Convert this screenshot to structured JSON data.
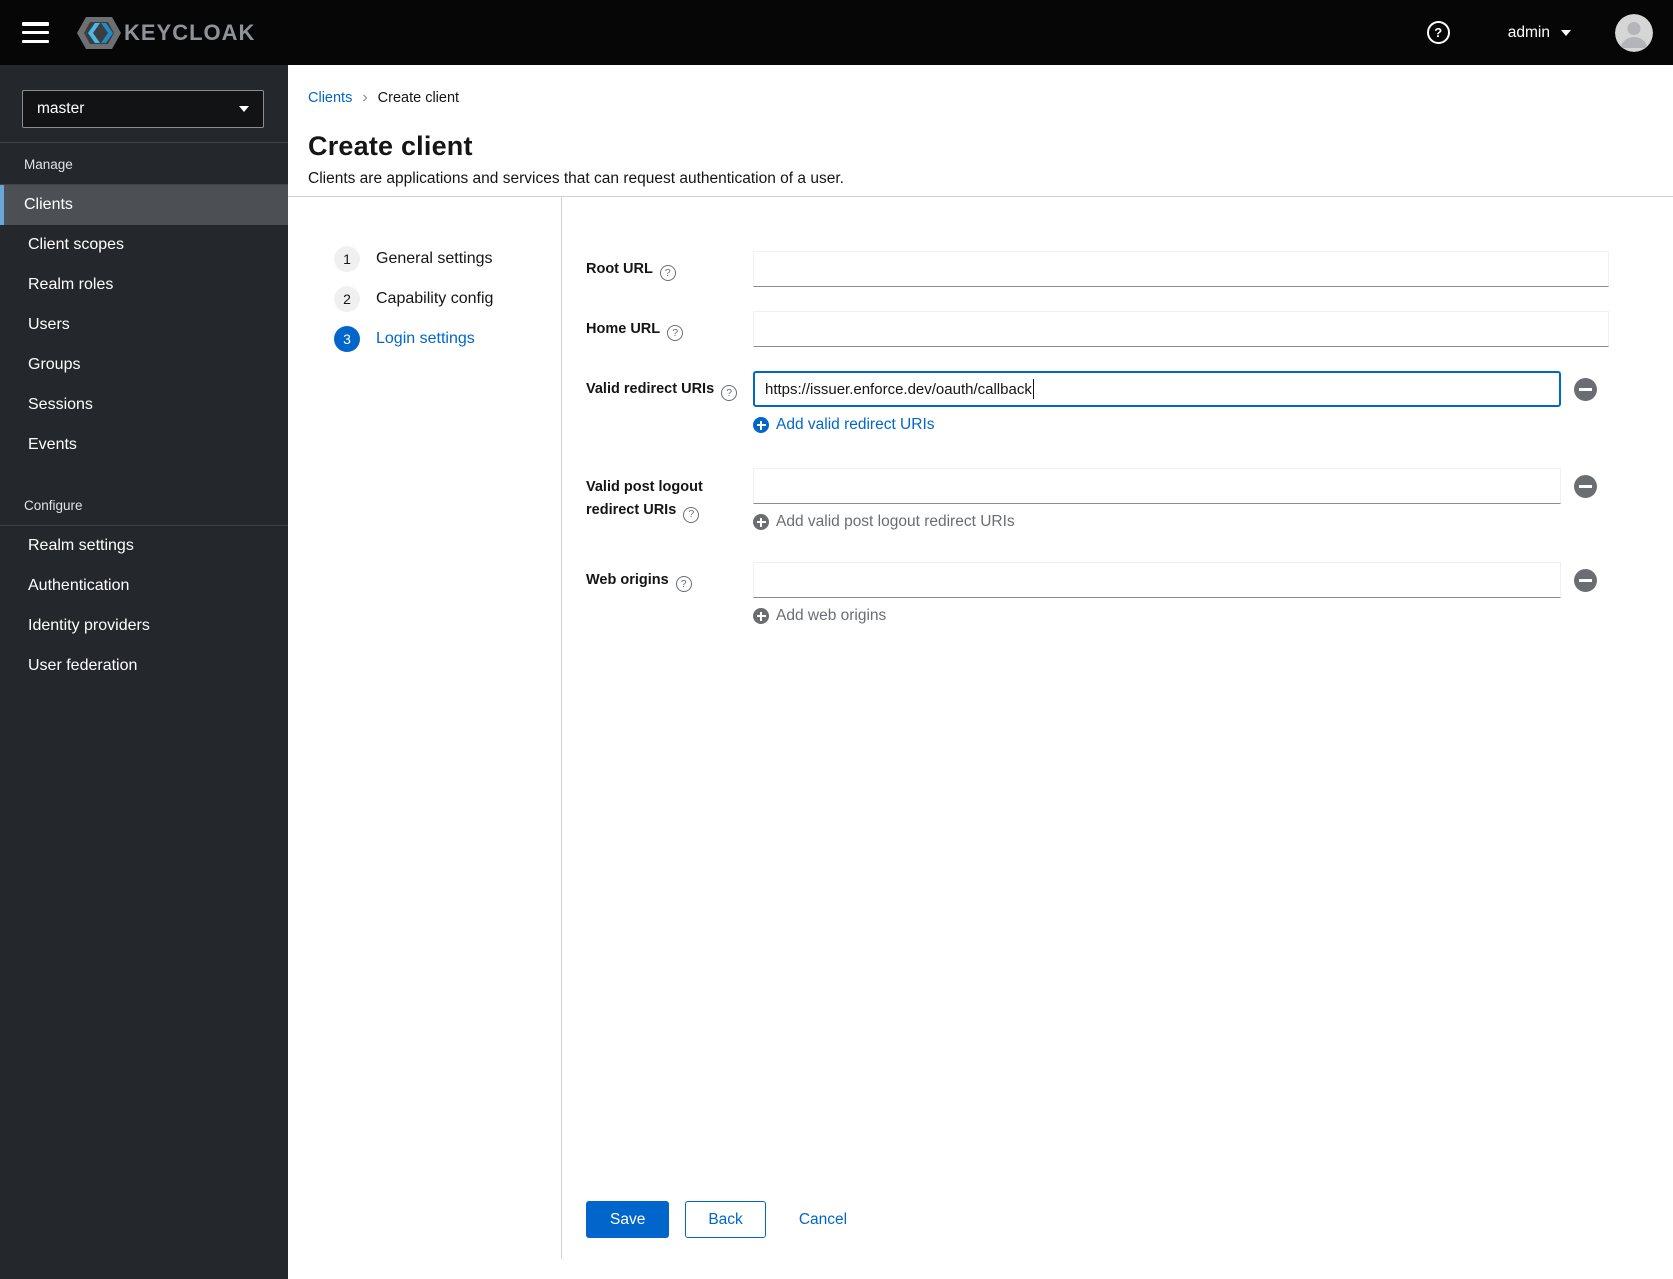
{
  "topbar": {
    "brand": "KEYCLOAK",
    "user": "admin"
  },
  "icons": {
    "help_glyph": "?"
  },
  "sidebar": {
    "realm": "master",
    "sections": [
      {
        "title": "Manage",
        "items": [
          "Clients",
          "Client scopes",
          "Realm roles",
          "Users",
          "Groups",
          "Sessions",
          "Events"
        ]
      },
      {
        "title": "Configure",
        "items": [
          "Realm settings",
          "Authentication",
          "Identity providers",
          "User federation"
        ]
      }
    ]
  },
  "breadcrumb": {
    "parent": "Clients",
    "separator": "›",
    "current": "Create client"
  },
  "page": {
    "title": "Create client",
    "subtitle": "Clients are applications and services that can request authentication of a user."
  },
  "wizard": {
    "steps": [
      {
        "number": "1",
        "label": "General settings"
      },
      {
        "number": "2",
        "label": "Capability config"
      },
      {
        "number": "3",
        "label": "Login settings"
      }
    ]
  },
  "form": {
    "root_url": {
      "label": "Root URL",
      "value": ""
    },
    "home_url": {
      "label": "Home URL",
      "value": ""
    },
    "valid_redirect_uris": {
      "label": "Valid redirect URIs",
      "value": "https://issuer.enforce.dev/oauth/callback",
      "add_label": "Add valid redirect URIs"
    },
    "post_logout_uris": {
      "label": "Valid post logout redirect URIs",
      "value": "",
      "add_label": "Add valid post logout redirect URIs"
    },
    "web_origins": {
      "label": "Web origins",
      "value": "",
      "add_label": "Add web origins"
    }
  },
  "actions": {
    "save": "Save",
    "back": "Back",
    "cancel": "Cancel"
  },
  "colors": {
    "primary": "#0066cc",
    "topbar_bg": "#060606",
    "sidebar_bg": "#24272b",
    "sidebar_selected_bg": "#4c5054",
    "sidebar_accent": "#6ba6d9",
    "disabled_gray": "#6a6e73",
    "divider": "#d2d2d2"
  }
}
